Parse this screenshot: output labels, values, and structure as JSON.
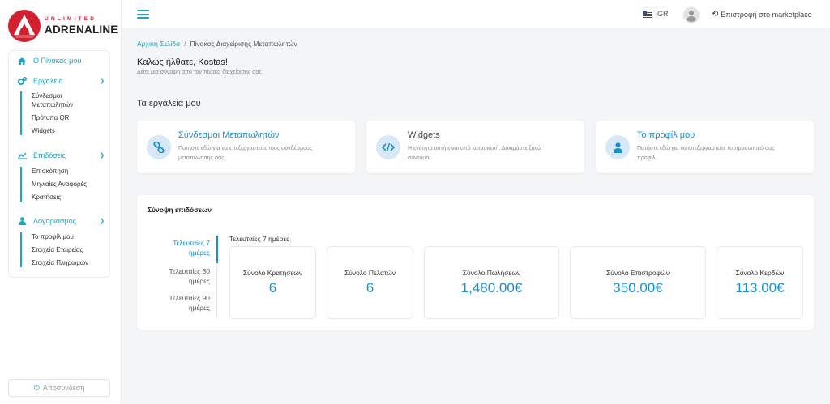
{
  "brand": {
    "top": "UNLIMITED",
    "bottom": "ADRENALINE",
    "color": "#d32030"
  },
  "accent": "#1aa5c2",
  "sidebar": {
    "home": {
      "label": "Ο Πίνακας μου",
      "icon": "home-icon"
    },
    "sections": [
      {
        "label": "Εργαλεία",
        "icon": "cogs-icon",
        "items": [
          "Σύνδεσμοι Μεταπωλητών",
          "Πρότυπα QR",
          "Widgets"
        ]
      },
      {
        "label": "Επιδόσεις",
        "icon": "chart-icon",
        "items": [
          "Επισκόπηση",
          "Μηνιαίες Αναφορές",
          "Κρατήσεις"
        ]
      },
      {
        "label": "Λογαριασμός",
        "icon": "user-icon",
        "items": [
          "Το προφίλ μου",
          "Στοιχεία Εταιρείας",
          "Στοιχεία Πληρωμών"
        ]
      }
    ],
    "logout": "Αποσύνδεση"
  },
  "topbar": {
    "lang": "GR",
    "back": "Επιστροφή στο marketplace"
  },
  "breadcrumb": {
    "home": "Αρχική Σελίδα",
    "current": "Πίνακας Διαχείρισης Μεταπωλητών"
  },
  "welcome": {
    "title": "Καλώς ήλθατε, Kostas!",
    "subtitle": "Δείτε μια σύνοψη από τον πίνακα διαχείρισης σας."
  },
  "tools": {
    "title": "Τα εργαλεία μου",
    "cards": [
      {
        "title": "Σύνδεσμοι Μεταπωλητών",
        "desc": "Πατήστε εδώ για να επεξεργαστείτε τους συνδέσμους μεταπώλησης σας.",
        "icon": "link-icon"
      },
      {
        "title": "Widgets",
        "desc": "Η ενότητα αυτή είναι υπό κατασκευή. Δοκιμάστε ξανά σύντομα.",
        "icon": "code-icon"
      },
      {
        "title": "Το προφίλ μου",
        "desc": "Πατήστε εδώ για να επεξεργαστείτε το προσωπικό σας προφίλ.",
        "icon": "profile-icon"
      }
    ]
  },
  "summary": {
    "title": "Σύνοψη επιδόσεων",
    "periods": [
      "Τελευταίες 7 ημέρες",
      "Τελευταίες 30 ημέρες",
      "Τελευταίες 90 ημέρες"
    ],
    "selected_period": "Τελευταίες 7 ημέρες",
    "stats": [
      {
        "label": "Σύνολο Κρατήσεων",
        "value": "6"
      },
      {
        "label": "Σύνολο Πελατών",
        "value": "6"
      },
      {
        "label": "Σύνολο Πωλήσεων",
        "value": "1,480.00€"
      },
      {
        "label": "Σύνολο Επιστροφών",
        "value": "350.00€"
      },
      {
        "label": "Σύνολο Κερδών",
        "value": "113.00€"
      }
    ]
  }
}
